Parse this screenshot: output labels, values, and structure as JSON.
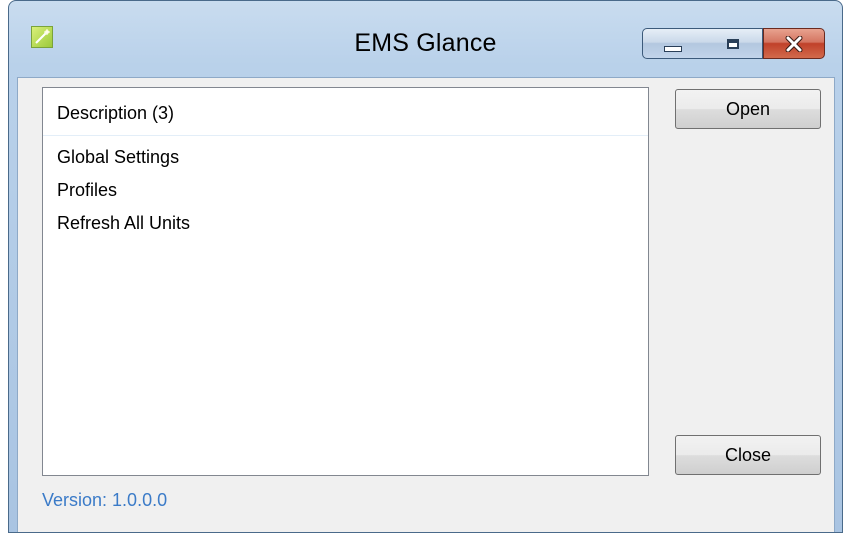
{
  "window": {
    "title": "EMS Glance",
    "icon": "app-icon"
  },
  "titlebar_buttons": {
    "minimize": "minimize-icon",
    "maximize": "maximize-icon",
    "close": "close-icon"
  },
  "list": {
    "header": "Description (3)",
    "items": [
      "Global Settings",
      "Profiles",
      "Refresh All Units"
    ]
  },
  "buttons": {
    "open": "Open",
    "close": "Close"
  },
  "footer": {
    "version": "Version: 1.0.0.0"
  },
  "colors": {
    "version_text": "#3b7bc8",
    "close_button": "#c0412a"
  }
}
